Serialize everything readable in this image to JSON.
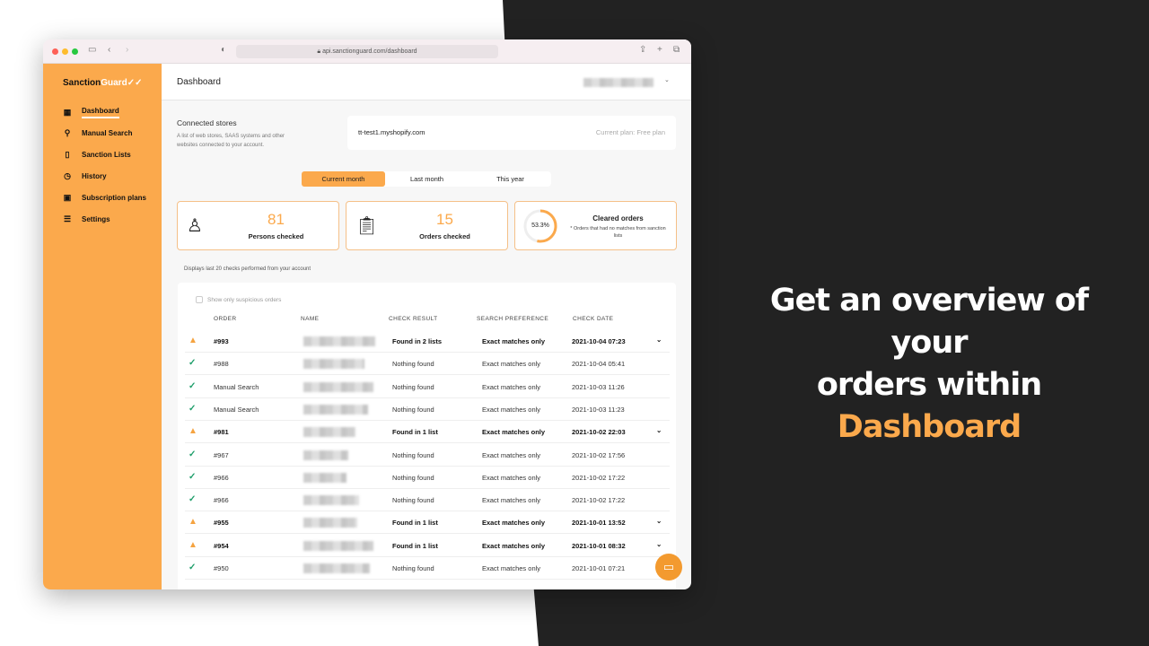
{
  "promo": {
    "line1": "Get an overview of your",
    "line2": "orders within",
    "highlight": "Dashboard"
  },
  "browser": {
    "url": "api.sanctionguard.com/dashboard"
  },
  "sidebar": {
    "logo_a": "Sanction",
    "logo_b": "Guard",
    "items": [
      {
        "label": "Dashboard",
        "icon": "grid-icon",
        "active": true
      },
      {
        "label": "Manual Search",
        "icon": "search-icon"
      },
      {
        "label": "Sanction Lists",
        "icon": "list-icon"
      },
      {
        "label": "History",
        "icon": "history-icon"
      },
      {
        "label": "Subscription plans",
        "icon": "plans-icon"
      },
      {
        "label": "Settings",
        "icon": "sliders-icon"
      }
    ]
  },
  "header": {
    "title": "Dashboard"
  },
  "stores": {
    "title": "Connected stores",
    "desc1": "A list of web stores, SAAS systems and other",
    "desc2": "websites connected to your account.",
    "store": "tt-test1.myshopify.com",
    "plan": "Current plan: Free plan"
  },
  "periods": {
    "items": [
      "Current month",
      "Last month",
      "This year"
    ],
    "selected": "Current month"
  },
  "stats": {
    "persons": {
      "value": "81",
      "label": "Persons checked"
    },
    "orders": {
      "value": "15",
      "label": "Orders checked"
    },
    "cleared": {
      "percent": "53.3%",
      "value": 53.3,
      "title": "Cleared orders",
      "note": "* Orders that had no matches from sanction lists"
    }
  },
  "table": {
    "caption": "Displays last 20 checks performed from your account",
    "filter": "Show only suspicious orders",
    "columns": [
      "ORDER",
      "NAME",
      "CHECK RESULT",
      "SEARCH PREFERENCE",
      "CHECK DATE"
    ],
    "rows": [
      {
        "status": "warning",
        "order": "#993",
        "result": "Found in 2 lists",
        "pref": "Exact matches only",
        "date": "2021-10-04 07:23"
      },
      {
        "status": "ok",
        "order": "#988",
        "result": "Nothing found",
        "pref": "Exact matches only",
        "date": "2021-10-04 05:41"
      },
      {
        "status": "ok",
        "order": "Manual Search",
        "result": "Nothing found",
        "pref": "Exact matches only",
        "date": "2021-10-03 11:26"
      },
      {
        "status": "ok",
        "order": "Manual Search",
        "result": "Nothing found",
        "pref": "Exact matches only",
        "date": "2021-10-03 11:23"
      },
      {
        "status": "warning",
        "order": "#981",
        "result": "Found in 1 list",
        "pref": "Exact matches only",
        "date": "2021-10-02 22:03"
      },
      {
        "status": "ok",
        "order": "#967",
        "result": "Nothing found",
        "pref": "Exact matches only",
        "date": "2021-10-02 17:56"
      },
      {
        "status": "ok",
        "order": "#966",
        "result": "Nothing found",
        "pref": "Exact matches only",
        "date": "2021-10-02 17:22"
      },
      {
        "status": "ok",
        "order": "#966",
        "result": "Nothing found",
        "pref": "Exact matches only",
        "date": "2021-10-02 17:22"
      },
      {
        "status": "warning",
        "order": "#955",
        "result": "Found in 1 list",
        "pref": "Exact matches only",
        "date": "2021-10-01 13:52"
      },
      {
        "status": "warning",
        "order": "#954",
        "result": "Found in 1 list",
        "pref": "Exact matches only",
        "date": "2021-10-01 08:32"
      },
      {
        "status": "ok",
        "order": "#950",
        "result": "Nothing found",
        "pref": "Exact matches only",
        "date": "2021-10-01 07:21"
      }
    ]
  },
  "colors": {
    "accent": "#FBA94C",
    "ok": "#1e9e6a",
    "dark": "#222222"
  }
}
